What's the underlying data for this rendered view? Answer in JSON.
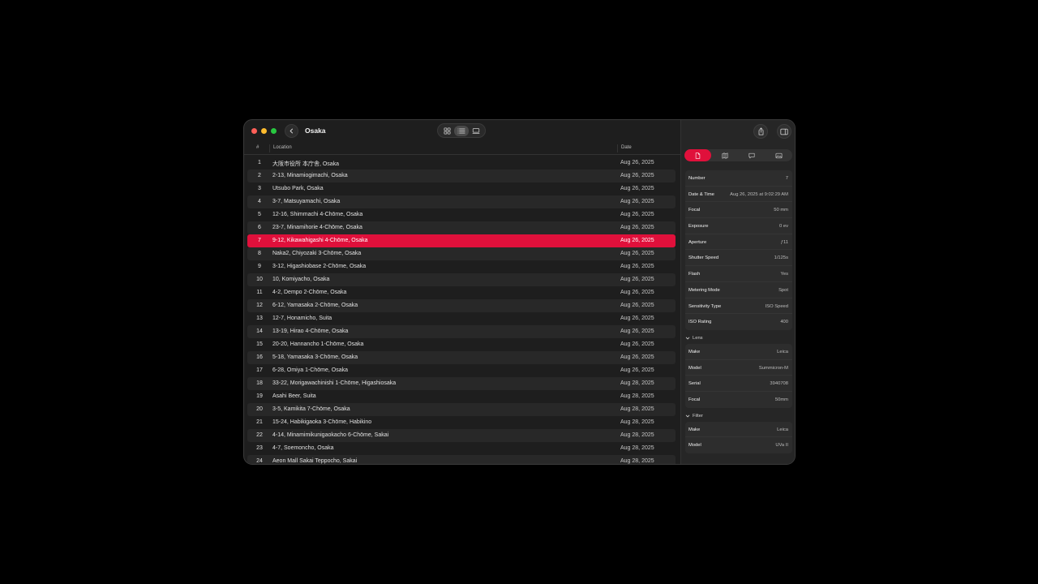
{
  "window": {
    "title": "Osaka"
  },
  "columns": {
    "num": "#",
    "location": "Location",
    "date": "Date"
  },
  "rows": [
    {
      "num": "1",
      "location": "大阪市役所 本庁舎, Osaka",
      "date": "Aug 26, 2025"
    },
    {
      "num": "2",
      "location": "2-13, Minamiogimachi, Osaka",
      "date": "Aug 26, 2025"
    },
    {
      "num": "3",
      "location": "Utsubo Park, Osaka",
      "date": "Aug 26, 2025"
    },
    {
      "num": "4",
      "location": "3-7, Matsuyamachi, Osaka",
      "date": "Aug 26, 2025"
    },
    {
      "num": "5",
      "location": "12-16, Shimmachi 4-Chōme, Osaka",
      "date": "Aug 26, 2025"
    },
    {
      "num": "6",
      "location": "23-7, Minamihorie 4-Chōme, Osaka",
      "date": "Aug 26, 2025"
    },
    {
      "num": "7",
      "location": "9-12, Kikawahigashi 4-Chōme, Osaka",
      "date": "Aug 26, 2025"
    },
    {
      "num": "8",
      "location": "Naka2, Chiyozaki 3-Chōme, Osaka",
      "date": "Aug 26, 2025"
    },
    {
      "num": "9",
      "location": "3-12, Higashiobase 2-Chōme, Osaka",
      "date": "Aug 26, 2025"
    },
    {
      "num": "10",
      "location": "10, Komiyacho, Osaka",
      "date": "Aug 26, 2025"
    },
    {
      "num": "11",
      "location": "4-2, Dempo 2-Chōme, Osaka",
      "date": "Aug 26, 2025"
    },
    {
      "num": "12",
      "location": "6-12, Yamasaka 2-Chōme, Osaka",
      "date": "Aug 26, 2025"
    },
    {
      "num": "13",
      "location": "12-7, Honamicho, Suita",
      "date": "Aug 26, 2025"
    },
    {
      "num": "14",
      "location": "13-19, Hirao 4-Chōme, Osaka",
      "date": "Aug 26, 2025"
    },
    {
      "num": "15",
      "location": "20-20, Hannancho 1-Chōme, Osaka",
      "date": "Aug 26, 2025"
    },
    {
      "num": "16",
      "location": "5-18, Yamasaka 3-Chōme, Osaka",
      "date": "Aug 26, 2025"
    },
    {
      "num": "17",
      "location": "6-28, Omiya 1-Chōme, Osaka",
      "date": "Aug 26, 2025"
    },
    {
      "num": "18",
      "location": "33-22, Morigawachinishi 1-Chōme, Higashiosaka",
      "date": "Aug 28, 2025"
    },
    {
      "num": "19",
      "location": "Asahi Beer, Suita",
      "date": "Aug 28, 2025"
    },
    {
      "num": "20",
      "location": "3-5, Kamikita 7-Chōme, Osaka",
      "date": "Aug 28, 2025"
    },
    {
      "num": "21",
      "location": "15-24, Habikigaoka 3-Chōme, Habikino",
      "date": "Aug 28, 2025"
    },
    {
      "num": "22",
      "location": "4-14, Minamimikunigaokacho 6-Chōme, Sakai",
      "date": "Aug 28, 2025"
    },
    {
      "num": "23",
      "location": "4-7, Soemoncho, Osaka",
      "date": "Aug 28, 2025"
    },
    {
      "num": "24",
      "location": "Aeon Mall Sakai Teppocho, Sakai",
      "date": "Aug 28, 2025"
    }
  ],
  "selected_row": "7",
  "details": [
    {
      "k": "Number",
      "v": "7"
    },
    {
      "k": "Date & Time",
      "v": "Aug 26, 2025 at 9:02:29 AM"
    },
    {
      "k": "Focal",
      "v": "50 mm"
    },
    {
      "k": "Exposure",
      "v": "0 ev"
    },
    {
      "k": "Aperture",
      "v": "ƒ11"
    },
    {
      "k": "Shutter Speed",
      "v": "1/125s"
    },
    {
      "k": "Flash",
      "v": "Yes"
    },
    {
      "k": "Metering Mode",
      "v": "Spot"
    },
    {
      "k": "Sensitivity Type",
      "v": "ISO Speed"
    },
    {
      "k": "ISO Rating",
      "v": "400"
    }
  ],
  "lens": {
    "heading": "Lens",
    "items": [
      {
        "k": "Make",
        "v": "Leica"
      },
      {
        "k": "Model",
        "v": "Summicron-M"
      },
      {
        "k": "Serial",
        "v": "3940708"
      },
      {
        "k": "Focal",
        "v": "50mm"
      }
    ]
  },
  "filter": {
    "heading": "Filter",
    "items": [
      {
        "k": "Make",
        "v": "Leica"
      },
      {
        "k": "Model",
        "v": "UVa II"
      }
    ]
  },
  "colors": {
    "accent": "#e0103b",
    "bg": "#1e1e1e",
    "sidebar": "#262626"
  },
  "icons": {
    "back": "chevron-left-icon",
    "grid": "grid-icon",
    "list": "list-icon",
    "film": "filmstrip-icon",
    "share": "share-icon",
    "sidebar": "sidebar-icon",
    "tabs": [
      "info-icon",
      "map-icon",
      "comment-icon",
      "photo-icon"
    ]
  }
}
